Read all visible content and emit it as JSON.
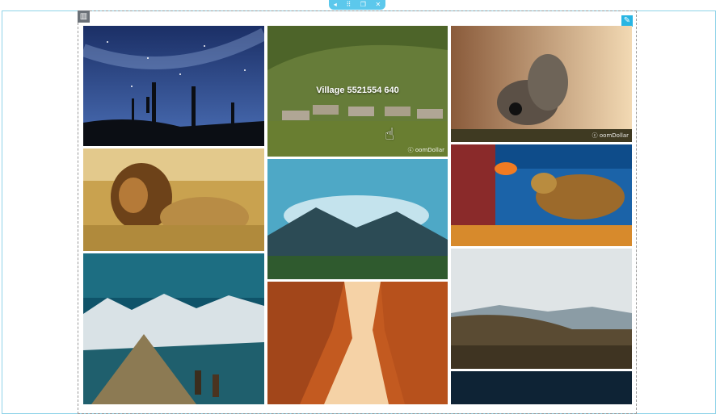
{
  "editor": {
    "toolbar_icons": [
      "arrow-icon",
      "drag-handle-icon",
      "duplicate-icon",
      "close-icon"
    ],
    "toolbar_glyphs": [
      "◂",
      "⠿",
      "❐",
      "✕"
    ],
    "column_handle_glyph": "▥",
    "edit_glyph": "✎",
    "accent_color": "#5cc8ec"
  },
  "gallery": {
    "hover_caption": "Village 5521554 640",
    "watermark": "ⓒ oomDollar",
    "images": [
      {
        "name": "night-sky-cactus"
      },
      {
        "name": "village-huts"
      },
      {
        "name": "butterfly"
      },
      {
        "name": "lion"
      },
      {
        "name": "misty-mountains"
      },
      {
        "name": "sea-turtle"
      },
      {
        "name": "mountain-hikers"
      },
      {
        "name": "red-canyon"
      },
      {
        "name": "forest-hills"
      },
      {
        "name": "dark-sky-partial"
      }
    ]
  }
}
